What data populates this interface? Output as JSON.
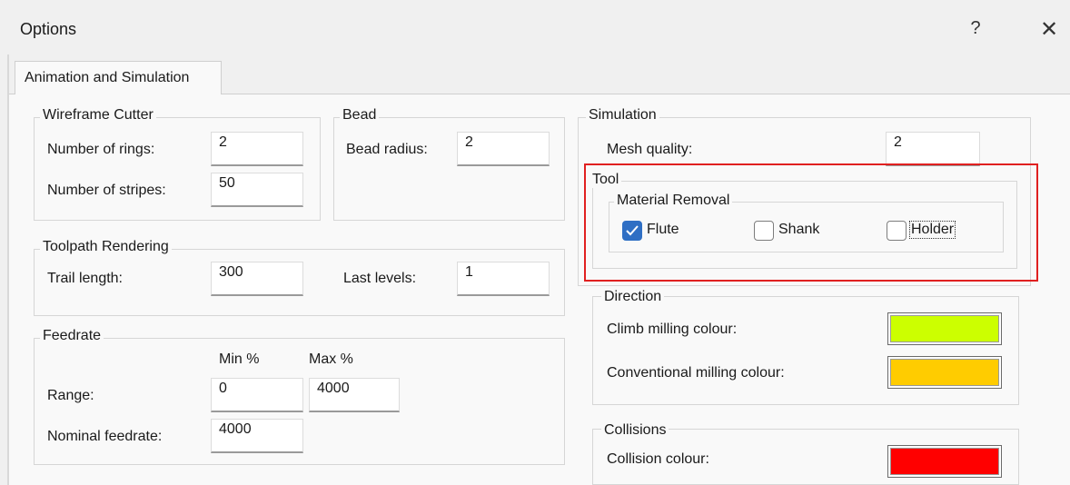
{
  "window": {
    "title": "Options",
    "help_label": "?",
    "close_label": "✕"
  },
  "tabs": [
    {
      "label": "Animation and Simulation",
      "active": true
    }
  ],
  "wireframe_cutter": {
    "legend": "Wireframe Cutter",
    "rings_label": "Number of rings:",
    "rings_value": "2",
    "stripes_label": "Number of stripes:",
    "stripes_value": "50"
  },
  "bead": {
    "legend": "Bead",
    "radius_label": "Bead radius:",
    "radius_value": "2"
  },
  "toolpath_rendering": {
    "legend": "Toolpath Rendering",
    "trail_label": "Trail length:",
    "trail_value": "300",
    "last_levels_label": "Last levels:",
    "last_levels_value": "1"
  },
  "feedrate": {
    "legend": "Feedrate",
    "min_header": "Min %",
    "max_header": "Max %",
    "range_label": "Range:",
    "range_min": "0",
    "range_max": "4000",
    "nominal_label": "Nominal feedrate:",
    "nominal_value": "4000"
  },
  "simulation": {
    "legend": "Simulation",
    "mesh_quality_label": "Mesh quality:",
    "mesh_quality_value": "2",
    "tool": {
      "legend": "Tool",
      "material_removal": {
        "legend": "Material Removal",
        "flute": {
          "label": "Flute",
          "checked": true
        },
        "shank": {
          "label": "Shank",
          "checked": false
        },
        "holder": {
          "label": "Holder",
          "checked": false
        }
      }
    },
    "direction": {
      "legend": "Direction",
      "climb_label": "Climb milling colour:",
      "climb_color": "#ccff00",
      "conventional_label": "Conventional milling colour:",
      "conventional_color": "#ffcc00"
    },
    "collisions": {
      "legend": "Collisions",
      "collision_label": "Collision colour:",
      "collision_color": "#ff0000"
    }
  },
  "colors": {
    "highlight": "#e02020",
    "accent": "#2f6fc4"
  }
}
